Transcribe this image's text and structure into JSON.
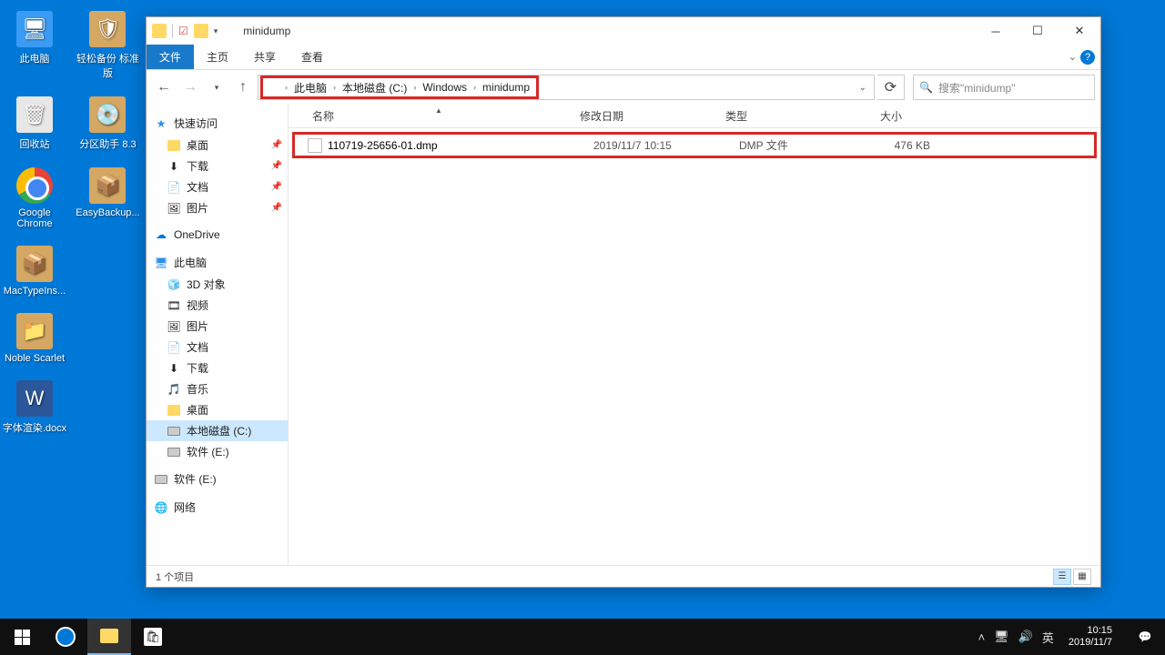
{
  "desktop_icons": [
    {
      "label": "此电脑",
      "icon": "pc"
    },
    {
      "label": "轻松备份 标准版",
      "icon": "box"
    },
    {
      "label": "回收站",
      "icon": "bin"
    },
    {
      "label": "分区助手 8.3",
      "icon": "box"
    },
    {
      "label": "Google Chrome",
      "icon": "chrome"
    },
    {
      "label": "EasyBackup...",
      "icon": "box"
    },
    {
      "label": "MacTypeIns...",
      "icon": "box"
    },
    {
      "label": "Noble Scarlet",
      "icon": "box"
    },
    {
      "label": "字体渲染.docx",
      "icon": "doc"
    }
  ],
  "window": {
    "title": "minidump",
    "tabs": {
      "file": "文件",
      "home": "主页",
      "share": "共享",
      "view": "查看"
    },
    "breadcrumb": [
      "此电脑",
      "本地磁盘 (C:)",
      "Windows",
      "minidump"
    ],
    "search_placeholder": "搜索\"minidump\"",
    "columns": {
      "name": "名称",
      "date": "修改日期",
      "type": "类型",
      "size": "大小"
    },
    "file": {
      "name": "110719-25656-01.dmp",
      "date": "2019/11/7 10:15",
      "type": "DMP 文件",
      "size": "476 KB"
    },
    "status": "1 个项目"
  },
  "sidebar": {
    "quick": {
      "label": "快速访问",
      "items": [
        {
          "label": "桌面",
          "pinned": true,
          "ico": "folder"
        },
        {
          "label": "下载",
          "pinned": true,
          "ico": "dl"
        },
        {
          "label": "文档",
          "pinned": true,
          "ico": "doc"
        },
        {
          "label": "图片",
          "pinned": true,
          "ico": "pic"
        }
      ]
    },
    "onedrive": "OneDrive",
    "thispc": {
      "label": "此电脑",
      "items": [
        {
          "label": "3D 对象"
        },
        {
          "label": "视频"
        },
        {
          "label": "图片"
        },
        {
          "label": "文档"
        },
        {
          "label": "下载"
        },
        {
          "label": "音乐"
        },
        {
          "label": "桌面"
        },
        {
          "label": "本地磁盘 (C:)",
          "selected": true,
          "ico": "drive"
        },
        {
          "label": "软件 (E:)",
          "ico": "drive"
        }
      ]
    },
    "extra_drive": "软件 (E:)",
    "network": "网络"
  },
  "taskbar": {
    "ime": "英",
    "time": "10:15",
    "date": "2019/11/7"
  }
}
